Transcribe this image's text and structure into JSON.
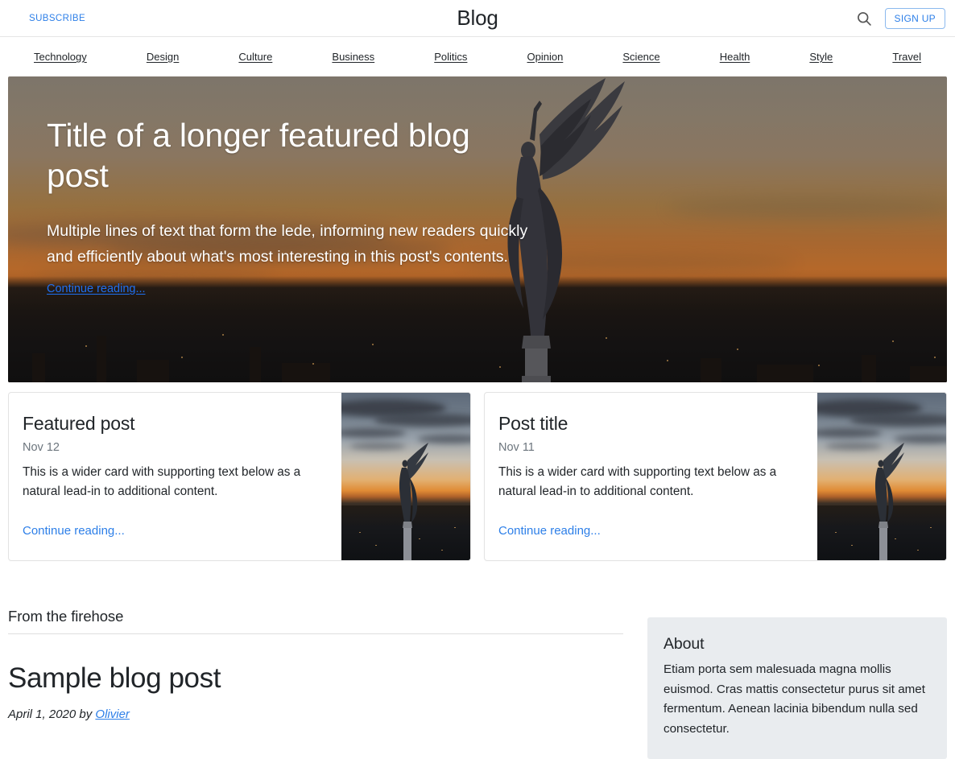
{
  "masthead": {
    "subscribe_label": "SUBSCRIBE",
    "title": "Blog",
    "search_icon": "search-icon",
    "signup_label": "SIGN UP"
  },
  "nav": {
    "items": [
      {
        "label": "Technology"
      },
      {
        "label": "Design"
      },
      {
        "label": "Culture"
      },
      {
        "label": "Business"
      },
      {
        "label": "Politics"
      },
      {
        "label": "Opinion"
      },
      {
        "label": "Science"
      },
      {
        "label": "Health"
      },
      {
        "label": "Style"
      },
      {
        "label": "Travel"
      }
    ]
  },
  "hero": {
    "title": "Title of a longer featured blog post",
    "lead": "Multiple lines of text that form the lede, informing new readers quickly and efficiently about what's most interesting in this post's contents.",
    "link_label": "Continue reading..."
  },
  "cards": [
    {
      "title": "Featured post",
      "date": "Nov 12",
      "text": "This is a wider card with supporting text below as a natural lead-in to additional content.",
      "link_label": "Continue reading...",
      "thumbnail": "statue-sunset-cityscape-image"
    },
    {
      "title": "Post title",
      "date": "Nov 11",
      "text": "This is a wider card with supporting text below as a natural lead-in to additional content.",
      "link_label": "Continue reading...",
      "thumbnail": "statue-sunset-cityscape-image"
    }
  ],
  "main": {
    "section_heading": "From the firehose",
    "post": {
      "title": "Sample blog post",
      "meta_prefix": "April 1, 2020 by ",
      "author": "Olivier"
    }
  },
  "sidebar": {
    "about_title": "About",
    "about_text": "Etiam porta sem malesuada magna mollis euismod. Cras mattis consectetur purus sit amet fermentum. Aenean lacinia bibendum nulla sed consectetur."
  },
  "colors": {
    "link_blue": "#2d7fe8",
    "hero_link_blue": "#1f6ff0",
    "text_dark": "#212529",
    "muted": "#6c757d",
    "about_bg": "#e9ecef",
    "border": "#e3e3e3"
  }
}
